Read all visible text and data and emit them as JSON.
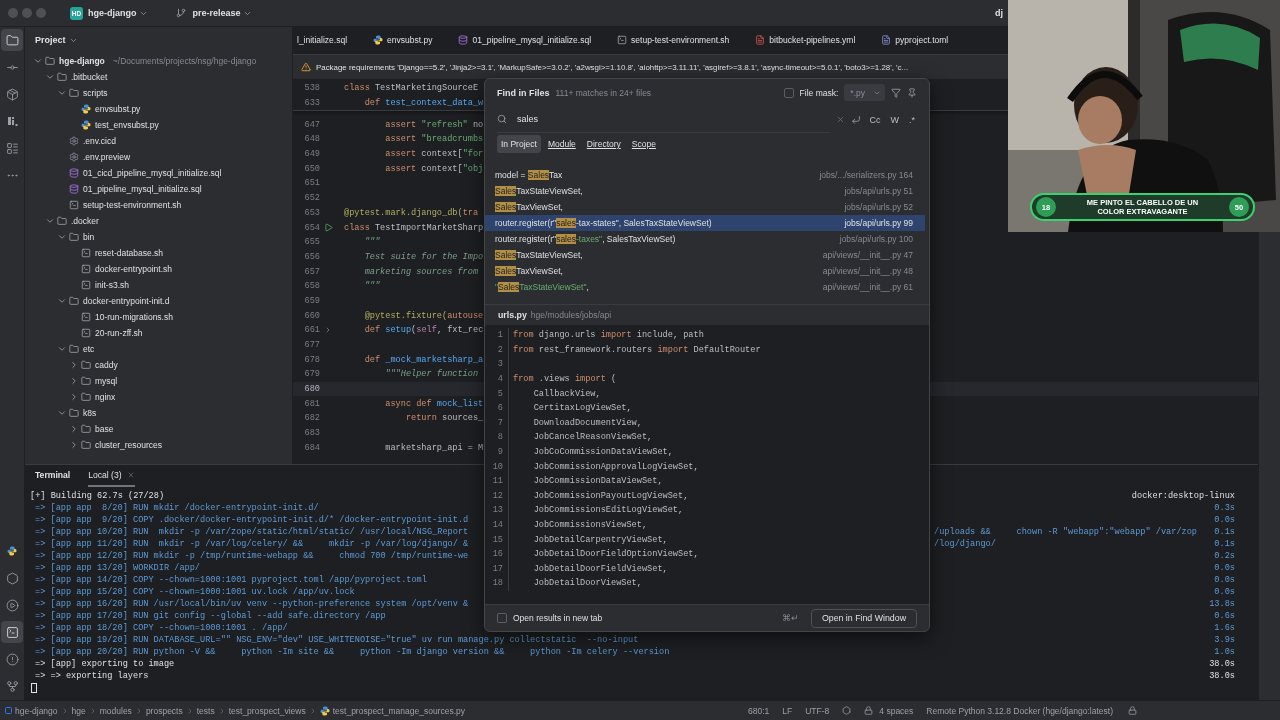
{
  "top_bar": {
    "project_badge": "HD",
    "project": "hge-django",
    "branch": "pre-release",
    "user_initials": "dj"
  },
  "tool_strip": {
    "top": [
      {
        "kind": "project",
        "selected": true
      },
      {
        "kind": "commit",
        "selected": false
      },
      {
        "kind": "packages",
        "selected": false
      },
      {
        "kind": "django",
        "selected": false
      },
      {
        "kind": "structure",
        "selected": false
      },
      {
        "kind": "more",
        "selected": false
      }
    ],
    "bottom": [
      {
        "kind": "python",
        "selected": false
      },
      {
        "kind": "services",
        "selected": false
      },
      {
        "kind": "run",
        "selected": false
      },
      {
        "kind": "terminal",
        "selected": true
      },
      {
        "kind": "problems",
        "selected": false
      },
      {
        "kind": "git",
        "selected": false
      }
    ]
  },
  "project": {
    "title": "Project",
    "tree": [
      {
        "name": "hge-django",
        "hint": "~/Documents/projects/nsg/hge-django",
        "kind": "folder",
        "expanded": true,
        "children": [
          {
            "name": ".bitbucket",
            "kind": "folder",
            "expanded": true,
            "children": [
              {
                "name": "scripts",
                "kind": "folder",
                "expanded": true,
                "children": [
                  {
                    "name": "envsubst.py",
                    "kind": "python"
                  },
                  {
                    "name": "test_envsubst.py",
                    "kind": "python"
                  }
                ]
              },
              {
                "name": ".env.cicd",
                "kind": "env"
              },
              {
                "name": ".env.preview",
                "kind": "env"
              },
              {
                "name": "01_cicd_pipeline_mysql_initialize.sql",
                "kind": "sql"
              },
              {
                "name": "01_pipeline_mysql_initialize.sql",
                "kind": "sql"
              },
              {
                "name": "setup-test-environment.sh",
                "kind": "shell"
              }
            ]
          },
          {
            "name": ".docker",
            "kind": "folder",
            "expanded": true,
            "children": [
              {
                "name": "bin",
                "kind": "folder",
                "expanded": true,
                "children": [
                  {
                    "name": "reset-database.sh",
                    "kind": "shell"
                  },
                  {
                    "name": "docker-entrypoint.sh",
                    "kind": "shell"
                  },
                  {
                    "name": "init-s3.sh",
                    "kind": "shell"
                  }
                ]
              },
              {
                "name": "docker-entrypoint-init.d",
                "kind": "folder",
                "expanded": true,
                "children": [
                  {
                    "name": "10-run-migrations.sh",
                    "kind": "shell"
                  },
                  {
                    "name": "20-run-zff.sh",
                    "kind": "shell"
                  }
                ]
              },
              {
                "name": "etc",
                "kind": "folder",
                "expanded": true,
                "children": [
                  {
                    "name": "caddy",
                    "kind": "folder",
                    "expanded": false
                  },
                  {
                    "name": "mysql",
                    "kind": "folder",
                    "expanded": false
                  },
                  {
                    "name": "nginx",
                    "kind": "folder",
                    "expanded": false
                  }
                ]
              },
              {
                "name": "k8s",
                "kind": "folder",
                "expanded": true,
                "children": [
                  {
                    "name": "base",
                    "kind": "folder",
                    "expanded": false
                  },
                  {
                    "name": "cluster_resources",
                    "kind": "folder",
                    "expanded": false
                  }
                ]
              }
            ]
          }
        ]
      }
    ]
  },
  "editor": {
    "tabs": [
      {
        "label": "l_initialize.sql",
        "kind": "clipped",
        "selected": false
      },
      {
        "label": "envsubst.py",
        "kind": "python",
        "selected": false
      },
      {
        "label": "01_pipeline_mysql_initialize.sql",
        "kind": "sql",
        "selected": false
      },
      {
        "label": "setup-test-environment.sh",
        "kind": "shell",
        "selected": false
      },
      {
        "label": "bitbucket-pipelines.yml",
        "kind": "yaml",
        "selected": false
      },
      {
        "label": "pyproject.toml",
        "kind": "toml",
        "selected": false
      }
    ],
    "warning": "Package requirements 'Django==5.2', 'Jinja2>=3.1', 'MarkupSafe>=3.0.2', 'a2wsgi>=1.10.8', 'aiohttp>=3.11.11', 'asgiref>=3.8.1', 'async-timeout>=5.0.1', 'boto3>=1.28', 'c...",
    "sticky_lines": [
      {
        "number": "538",
        "current": false,
        "segments": [
          {
            "text": "class ",
            "kind": "keyword"
          },
          {
            "text": "TestMarketingSourceE",
            "kind": "plain"
          }
        ]
      },
      {
        "number": "633",
        "current": false,
        "segments": [
          {
            "text": "    def ",
            "kind": "keyword"
          },
          {
            "text": "test_context_data_w",
            "kind": "function"
          }
        ]
      }
    ],
    "lines": [
      {
        "number": "647",
        "current": false,
        "segments": [
          {
            "text": "        assert ",
            "kind": "keyword"
          },
          {
            "text": "\"refresh\"",
            "kind": "string"
          },
          {
            "text": " no",
            "kind": "plain"
          }
        ]
      },
      {
        "number": "648",
        "current": false,
        "segments": [
          {
            "text": "        assert ",
            "kind": "keyword"
          },
          {
            "text": "\"breadcrumbs",
            "kind": "string"
          }
        ]
      },
      {
        "number": "649",
        "current": false,
        "segments": [
          {
            "text": "        assert ",
            "kind": "keyword"
          },
          {
            "text": "context[",
            "kind": "plain"
          },
          {
            "text": "\"for",
            "kind": "string"
          }
        ]
      },
      {
        "number": "650",
        "current": false,
        "segments": [
          {
            "text": "        assert ",
            "kind": "keyword"
          },
          {
            "text": "context[",
            "kind": "plain"
          },
          {
            "text": "\"obj",
            "kind": "string"
          }
        ]
      },
      {
        "number": "651",
        "current": false
      },
      {
        "number": "652",
        "current": false
      },
      {
        "number": "653",
        "current": false,
        "segments": [
          {
            "text": "@pytest.mark.django_db(",
            "kind": "decorator"
          },
          {
            "text": "tra",
            "kind": "keyword"
          }
        ]
      },
      {
        "number": "654",
        "current": false,
        "runnable": true,
        "segments": [
          {
            "text": "class ",
            "kind": "keyword"
          },
          {
            "text": "TestImportMarketSharp",
            "kind": "plain"
          }
        ]
      },
      {
        "number": "655",
        "current": false,
        "segments": [
          {
            "text": "    \"\"\"",
            "kind": "doc"
          }
        ]
      },
      {
        "number": "656",
        "current": false,
        "segments": [
          {
            "text": "    Test suite for the Impo",
            "kind": "doc"
          }
        ]
      },
      {
        "number": "657",
        "current": false,
        "segments": [
          {
            "text": "    marketing sources from",
            "kind": "doc"
          }
        ]
      },
      {
        "number": "658",
        "current": false,
        "segments": [
          {
            "text": "    \"\"\"",
            "kind": "doc"
          }
        ]
      },
      {
        "number": "659",
        "current": false
      },
      {
        "number": "660",
        "current": false,
        "segments": [
          {
            "text": "    @pytest.fixture(",
            "kind": "decorator"
          },
          {
            "text": "autouse",
            "kind": "keyword"
          }
        ]
      },
      {
        "number": "661",
        "current": false,
        "folded": true,
        "segments": [
          {
            "text": "    def ",
            "kind": "keyword"
          },
          {
            "text": "setup",
            "kind": "function"
          },
          {
            "text": "(",
            "kind": "plain"
          },
          {
            "text": "self",
            "kind": "param"
          },
          {
            "text": ", fxt_rec",
            "kind": "plain"
          }
        ]
      },
      {
        "number": "677",
        "current": false
      },
      {
        "number": "678",
        "current": false,
        "segments": [
          {
            "text": "    def ",
            "kind": "keyword"
          },
          {
            "text": "_mock_marketsharp_a",
            "kind": "function"
          }
        ]
      },
      {
        "number": "679",
        "current": false,
        "segments": [
          {
            "text": "        \"\"\"Helper function",
            "kind": "doc"
          }
        ]
      },
      {
        "number": "680",
        "current": true
      },
      {
        "number": "681",
        "current": false,
        "segments": [
          {
            "text": "        async def ",
            "kind": "keyword"
          },
          {
            "text": "mock_list",
            "kind": "function"
          }
        ]
      },
      {
        "number": "682",
        "current": false,
        "segments": [
          {
            "text": "            return ",
            "kind": "keyword"
          },
          {
            "text": "sources_",
            "kind": "plain"
          }
        ]
      },
      {
        "number": "683",
        "current": false
      },
      {
        "number": "684",
        "current": false,
        "segments": [
          {
            "text": "        marketsharp_api = M",
            "kind": "plain"
          }
        ]
      }
    ]
  },
  "terminal": {
    "tabs": [
      {
        "label": "Terminal",
        "kind": "title",
        "selected": false
      },
      {
        "label": "Local (3)",
        "kind": "session",
        "selected": true
      }
    ],
    "lines": [
      {
        "kind": "header",
        "text": "[+] Building 62.7s (27/28)",
        "right": "docker:desktop-linux"
      },
      {
        "kind": "step",
        "text": "=> [app app  8/20] RUN mkdir /docker-entrypoint-init.d/",
        "right": "0.3s"
      },
      {
        "kind": "step",
        "text": "=> [app app  9/20] COPY .docker/docker-entrypoint-init.d/* /docker-entrypoint-init.d",
        "right": "0.0s"
      },
      {
        "kind": "step",
        "text": "=> [app app 10/20] RUN  mkdir -p /var/zope/static/html/static/ /usr/local/NSG_Report",
        "tail": "/uploads &&     chown -R \"webapp\":\"webapp\" /var/zop",
        "right": "0.1s"
      },
      {
        "kind": "step",
        "text": "=> [app app 11/20] RUN  mkdir -p /var/log/celery/ &&     mkdir -p /var/log/django/ &",
        "tail": "/log/django/",
        "right": "0.1s"
      },
      {
        "kind": "step",
        "text": "=> [app app 12/20] RUN mkdir -p /tmp/runtime-webapp &&     chmod 700 /tmp/runtime-we",
        "right": "0.2s"
      },
      {
        "kind": "step",
        "text": "=> [app app 13/20] WORKDIR /app/",
        "right": "0.0s"
      },
      {
        "kind": "step",
        "text": "=> [app app 14/20] COPY --chown=1000:1001 pyproject.toml /app/pyproject.toml",
        "right": "0.0s"
      },
      {
        "kind": "step",
        "text": "=> [app app 15/20] COPY --chown=1000:1001 uv.lock /app/uv.lock",
        "right": "0.0s"
      },
      {
        "kind": "step",
        "text": "=> [app app 16/20] RUN /usr/local/bin/uv venv --python-preference system /opt/venv &",
        "right": "13.8s"
      },
      {
        "kind": "step",
        "text": "=> [app app 17/20] RUN git config --global --add safe.directory /app",
        "right": "0.6s"
      },
      {
        "kind": "step",
        "text": "=> [app app 18/20] COPY --chown=1000:1001 . /app/",
        "right": "1.6s"
      },
      {
        "kind": "step",
        "text": "=> [app app 19/20] RUN DATABASE_URL=\"\" NSG_ENV=\"dev\" USE_WHITENOISE=\"true\" uv run manage.py collectstatic  --no-input",
        "right": "3.9s"
      },
      {
        "kind": "step",
        "text": "=> [app app 20/20] RUN python -V &&     python -Im site &&     python -Im django version &&     python -Im celery --version",
        "right": "1.0s"
      },
      {
        "kind": "export",
        "text": "=> [app] exporting to image",
        "right": "38.0s"
      },
      {
        "kind": "export",
        "text": "=> => exporting layers",
        "right": "38.0s"
      }
    ]
  },
  "find_popup": {
    "title": "Find in Files",
    "summary": "111+ matches in 24+ files",
    "file_mask": {
      "label": "File mask:",
      "checked": false,
      "value": "*.py",
      "disabled": true
    },
    "query": "sales",
    "toggles": [
      {
        "label": "Cc",
        "on": false
      },
      {
        "label": "W",
        "on": false
      },
      {
        "label": ".*",
        "on": false
      }
    ],
    "scopes": [
      {
        "label": "In Project",
        "selected": true
      },
      {
        "label": "Module",
        "selected": false
      },
      {
        "label": "Directory",
        "selected": false
      },
      {
        "label": "Scope",
        "selected": false
      }
    ],
    "results": [
      {
        "selected": false,
        "location": "jobs/.../serializers.py 164",
        "segments": [
          {
            "text": "model = ",
            "kind": "plain"
          },
          {
            "text": "Sales",
            "kind": "match"
          },
          {
            "text": "Tax",
            "kind": "plain"
          }
        ]
      },
      {
        "selected": false,
        "location": "jobs/api/urls.py 51",
        "segments": [
          {
            "text": "Sales",
            "kind": "match"
          },
          {
            "text": "TaxStateViewSet,",
            "kind": "plain"
          }
        ]
      },
      {
        "selected": false,
        "location": "jobs/api/urls.py 52",
        "segments": [
          {
            "text": "Sales",
            "kind": "match"
          },
          {
            "text": "TaxViewSet,",
            "kind": "plain"
          }
        ]
      },
      {
        "selected": true,
        "location": "jobs/api/urls.py 99",
        "segments": [
          {
            "text": "router.register(r\"",
            "kind": "plain"
          },
          {
            "text": "sales",
            "kind": "match"
          },
          {
            "text": "-tax-states\", SalesTaxStateViewSet)",
            "kind": "plain"
          }
        ]
      },
      {
        "selected": false,
        "location": "jobs/api/urls.py 100",
        "segments": [
          {
            "text": "router.register(r\"",
            "kind": "plain"
          },
          {
            "text": "sales",
            "kind": "match"
          },
          {
            "text": "-taxes\"",
            "kind": "string"
          },
          {
            "text": ", SalesTaxViewSet)",
            "kind": "plain"
          }
        ]
      },
      {
        "selected": false,
        "location": "api/views/__init__.py 47",
        "segments": [
          {
            "text": "Sales",
            "kind": "match"
          },
          {
            "text": "TaxStateViewSet,",
            "kind": "plain"
          }
        ]
      },
      {
        "selected": false,
        "location": "api/views/__init__.py 48",
        "segments": [
          {
            "text": "Sales",
            "kind": "match"
          },
          {
            "text": "TaxViewSet,",
            "kind": "plain"
          }
        ]
      },
      {
        "selected": false,
        "location": "api/views/__init__.py 61",
        "segments": [
          {
            "text": "\"",
            "kind": "string"
          },
          {
            "text": "Sales",
            "kind": "match"
          },
          {
            "text": "TaxStateViewSet\"",
            "kind": "string"
          },
          {
            "text": ",",
            "kind": "plain"
          }
        ]
      }
    ],
    "preview": {
      "file": "urls.py",
      "path": "hge/modules/jobs/api",
      "lines": [
        {
          "number": "1",
          "segments": [
            {
              "text": "from",
              "kind": "keyword"
            },
            {
              "text": " django.urls ",
              "kind": "plain"
            },
            {
              "text": "import",
              "kind": "keyword"
            },
            {
              "text": " include, path",
              "kind": "plain"
            }
          ]
        },
        {
          "number": "2",
          "segments": [
            {
              "text": "from",
              "kind": "keyword"
            },
            {
              "text": " rest_framework.routers ",
              "kind": "plain"
            },
            {
              "text": "import",
              "kind": "keyword"
            },
            {
              "text": " DefaultRouter",
              "kind": "plain"
            }
          ]
        },
        {
          "number": "3"
        },
        {
          "number": "4",
          "segments": [
            {
              "text": "from",
              "kind": "keyword"
            },
            {
              "text": " .views ",
              "kind": "plain"
            },
            {
              "text": "import",
              "kind": "keyword"
            },
            {
              "text": " (",
              "kind": "plain"
            }
          ]
        },
        {
          "number": "5",
          "segments": [
            {
              "text": "    CallbackView,",
              "kind": "plain"
            }
          ]
        },
        {
          "number": "6",
          "segments": [
            {
              "text": "    CertitaxLogViewSet,",
              "kind": "plain"
            }
          ]
        },
        {
          "number": "7",
          "segments": [
            {
              "text": "    DownloadDocumentView,",
              "kind": "plain"
            }
          ]
        },
        {
          "number": "8",
          "segments": [
            {
              "text": "    JobCancelReasonViewSet,",
              "kind": "plain"
            }
          ]
        },
        {
          "number": "9",
          "segments": [
            {
              "text": "    JobCoCommissionDataViewSet,",
              "kind": "plain"
            }
          ]
        },
        {
          "number": "10",
          "segments": [
            {
              "text": "    JobCommissionApprovalLogViewSet,",
              "kind": "plain"
            }
          ]
        },
        {
          "number": "11",
          "segments": [
            {
              "text": "    JobCommissionDataViewSet,",
              "kind": "plain"
            }
          ]
        },
        {
          "number": "12",
          "segments": [
            {
              "text": "    JobCommissionPayoutLogViewSet,",
              "kind": "plain"
            }
          ]
        },
        {
          "number": "13",
          "segments": [
            {
              "text": "    JobCommissionsEditLogViewSet,",
              "kind": "plain"
            }
          ]
        },
        {
          "number": "14",
          "segments": [
            {
              "text": "    JobCommissionsViewSet,",
              "kind": "plain"
            }
          ]
        },
        {
          "number": "15",
          "segments": [
            {
              "text": "    JobDetailCarpentryViewSet,",
              "kind": "plain"
            }
          ]
        },
        {
          "number": "16",
          "segments": [
            {
              "text": "    JobDetailDoorFieldOptionViewSet,",
              "kind": "plain"
            }
          ]
        },
        {
          "number": "17",
          "segments": [
            {
              "text": "    JobDetailDoorFieldViewSet,",
              "kind": "plain"
            }
          ]
        },
        {
          "number": "18",
          "segments": [
            {
              "text": "    JobDetailDoorViewSet,",
              "kind": "plain"
            }
          ]
        }
      ]
    },
    "new_tab": {
      "label": "Open results in new tab",
      "checked": false
    },
    "shortcut": "⌘↵",
    "open_button": "Open in Find Window"
  },
  "webcam": {
    "kind": "picture",
    "poll": {
      "left_count": "18",
      "title": "ME PINTO EL CABELLO DE UN COLOR EXTRAVAGANTE",
      "right_count": "50"
    }
  },
  "status_bar": {
    "breadcrumbs": [
      {
        "label": "hge-django",
        "kind": "module"
      },
      {
        "label": "hge",
        "kind": "plain"
      },
      {
        "label": "modules",
        "kind": "plain"
      },
      {
        "label": "prospects",
        "kind": "plain"
      },
      {
        "label": "tests",
        "kind": "plain"
      },
      {
        "label": "test_prospect_views",
        "kind": "plain"
      },
      {
        "label": "test_prospect_manage_sources.py",
        "kind": "python"
      }
    ],
    "position": "680:1",
    "line_separator": "LF",
    "encoding": "UTF-8",
    "indent": "4 spaces",
    "interpreter": "Remote Python 3.12.8 Docker (hge/django:latest)"
  }
}
